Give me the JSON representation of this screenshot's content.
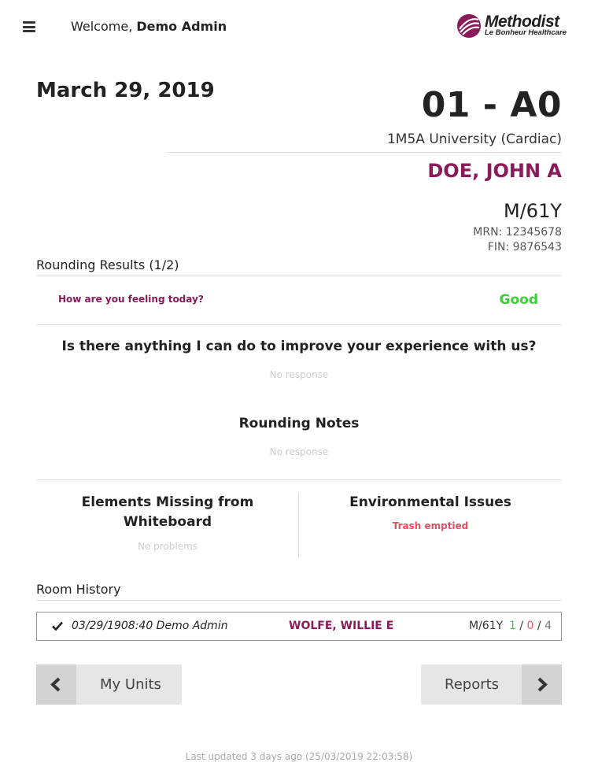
{
  "header": {
    "welcome_prefix": "Welcome,",
    "user_name": "Demo Admin",
    "logo_name": "Methodist",
    "logo_subtitle": "Le Bonheur Healthcare"
  },
  "visit": {
    "date": "March 29, 2019",
    "room": "01 - A0",
    "unit": "1M5A University (Cardiac)",
    "patient_name": "DOE, JOHN A",
    "sex_age": "M/61Y",
    "mrn": "MRN: 12345678",
    "fin": "FIN: 9876543"
  },
  "rounding": {
    "title": "Rounding Results (1/2)",
    "question1": "How are you feeling today?",
    "answer1": "Good",
    "question2": "Is there anything I can do to improve your experience with us?",
    "answer2": "No response",
    "notes_title": "Rounding Notes",
    "notes_value": "No response",
    "whiteboard_title": "Elements Missing from Whiteboard",
    "whiteboard_value": "No problems",
    "env_title": "Environmental Issues",
    "env_value": "Trash emptied"
  },
  "room_history": {
    "title": "Room History",
    "rows": [
      {
        "datetime_user": "03/29/1908:40 Demo Admin",
        "patient": "WOLFE, WILLIE E",
        "sex_age": "M/61Y",
        "count_good": "1",
        "count_bad": "0",
        "count_total": "4",
        "sep": "/"
      }
    ]
  },
  "nav": {
    "back_label": "My Units",
    "forward_label": "Reports"
  },
  "footer": {
    "last_updated": "Last updated 3 days ago (25/03/2019 22:03:58)"
  },
  "colors": {
    "accent": "#8a1a5a",
    "good": "#3ccf3c",
    "bad": "#e05060"
  }
}
